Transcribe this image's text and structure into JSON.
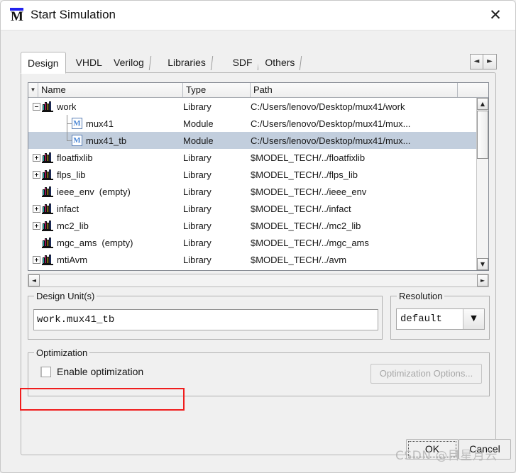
{
  "window": {
    "title": "Start Simulation",
    "logo_icon": "modelsim-m-logo",
    "close_icon": "✕"
  },
  "tabs": [
    {
      "label": "Design",
      "active": true
    },
    {
      "label": "VHDL",
      "active": false
    },
    {
      "label": "Verilog",
      "active": false
    },
    {
      "label": "Libraries",
      "active": false
    },
    {
      "label": "SDF",
      "active": false
    },
    {
      "label": "Others",
      "active": false
    }
  ],
  "tab_arrows": {
    "left": "◄",
    "right": "►"
  },
  "tree": {
    "sort_marker": "▼",
    "columns": [
      "Name",
      "Type",
      "Path"
    ],
    "rows": [
      {
        "name": "work",
        "type": "Library",
        "path": "C:/Users/lenovo/Desktop/mux41/work",
        "level": 0,
        "icon": "library-icon",
        "expander": "minus",
        "selected": false,
        "empty": ""
      },
      {
        "name": "mux41",
        "type": "Module",
        "path": "C:/Users/lenovo/Desktop/mux41/mux...",
        "level": 1,
        "icon": "module-icon",
        "expander": "none",
        "selected": false,
        "empty": ""
      },
      {
        "name": "mux41_tb",
        "type": "Module",
        "path": "C:/Users/lenovo/Desktop/mux41/mux...",
        "level": 1,
        "icon": "module-icon",
        "expander": "none",
        "selected": true,
        "empty": ""
      },
      {
        "name": "floatfixlib",
        "type": "Library",
        "path": "$MODEL_TECH/../floatfixlib",
        "level": 0,
        "icon": "library-icon",
        "expander": "plus",
        "selected": false,
        "empty": ""
      },
      {
        "name": "flps_lib",
        "type": "Library",
        "path": "$MODEL_TECH/../flps_lib",
        "level": 0,
        "icon": "library-icon",
        "expander": "plus",
        "selected": false,
        "empty": ""
      },
      {
        "name": "ieee_env",
        "type": "Library",
        "path": "$MODEL_TECH/../ieee_env",
        "level": 0,
        "icon": "library-icon",
        "expander": "none",
        "selected": false,
        "empty": "(empty)"
      },
      {
        "name": "infact",
        "type": "Library",
        "path": "$MODEL_TECH/../infact",
        "level": 0,
        "icon": "library-icon",
        "expander": "plus",
        "selected": false,
        "empty": ""
      },
      {
        "name": "mc2_lib",
        "type": "Library",
        "path": "$MODEL_TECH/../mc2_lib",
        "level": 0,
        "icon": "library-icon",
        "expander": "plus",
        "selected": false,
        "empty": ""
      },
      {
        "name": "mgc_ams",
        "type": "Library",
        "path": "$MODEL_TECH/../mgc_ams",
        "level": 0,
        "icon": "library-icon",
        "expander": "none",
        "selected": false,
        "empty": "(empty)"
      },
      {
        "name": "mtiAvm",
        "type": "Library",
        "path": "$MODEL_TECH/../avm",
        "level": 0,
        "icon": "library-icon",
        "expander": "plus",
        "selected": false,
        "empty": ""
      }
    ],
    "scroll": {
      "up": "▲",
      "down": "▼",
      "left": "◄",
      "right": "►"
    }
  },
  "design_units": {
    "group_title": "Design Unit(s)",
    "value": "work.mux41_tb",
    "placeholder": ""
  },
  "resolution": {
    "group_title": "Resolution",
    "value": "default",
    "arrow_icon": "▼"
  },
  "optimization": {
    "group_title": "Optimization",
    "checkbox_label": "Enable optimization",
    "checked": false,
    "options_button": "Optimization Options...",
    "options_button_enabled": false,
    "annotation_color": "#f01d1d"
  },
  "footer": {
    "ok": "OK",
    "cancel": "Cancel"
  },
  "watermark": "CSDN @目星月云"
}
